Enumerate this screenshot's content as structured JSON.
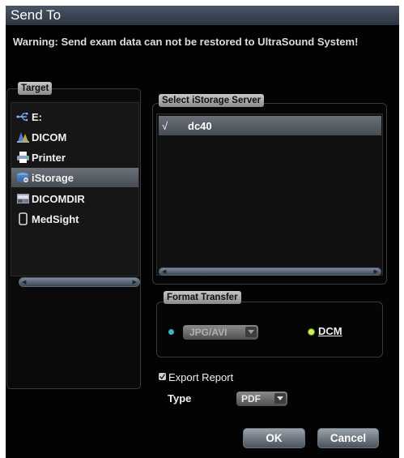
{
  "dialog": {
    "title": "Send To"
  },
  "warning": "Warning: Send exam data can not be restored to UltraSound System!",
  "target": {
    "legend": "Target",
    "items": [
      {
        "label": "E:",
        "icon": "usb-icon"
      },
      {
        "label": "DICOM",
        "icon": "dicom-icon"
      },
      {
        "label": "Printer",
        "icon": "printer-icon"
      },
      {
        "label": "iStorage",
        "icon": "istorage-icon",
        "selected": true
      },
      {
        "label": "DICOMDIR",
        "icon": "dicomdir-icon"
      },
      {
        "label": "MedSight",
        "icon": "medsight-icon"
      }
    ]
  },
  "server": {
    "legend": "Select iStorage Server",
    "rows": [
      {
        "check": "√",
        "name": "dc40",
        "selected": true
      }
    ]
  },
  "format": {
    "legend": "Format Transfer",
    "options": [
      {
        "label": "JPG/AVI",
        "selected": false,
        "enabled": false
      },
      {
        "label": "DCM",
        "selected": true,
        "enabled": true
      }
    ]
  },
  "export": {
    "label": "Export Report",
    "checked": true
  },
  "type": {
    "label": "Type",
    "value": "PDF"
  },
  "buttons": {
    "ok": "OK",
    "cancel": "Cancel"
  },
  "colors": {
    "selection": "#5b6168",
    "frame": "#3a3a3a",
    "title": "#3a4452"
  }
}
